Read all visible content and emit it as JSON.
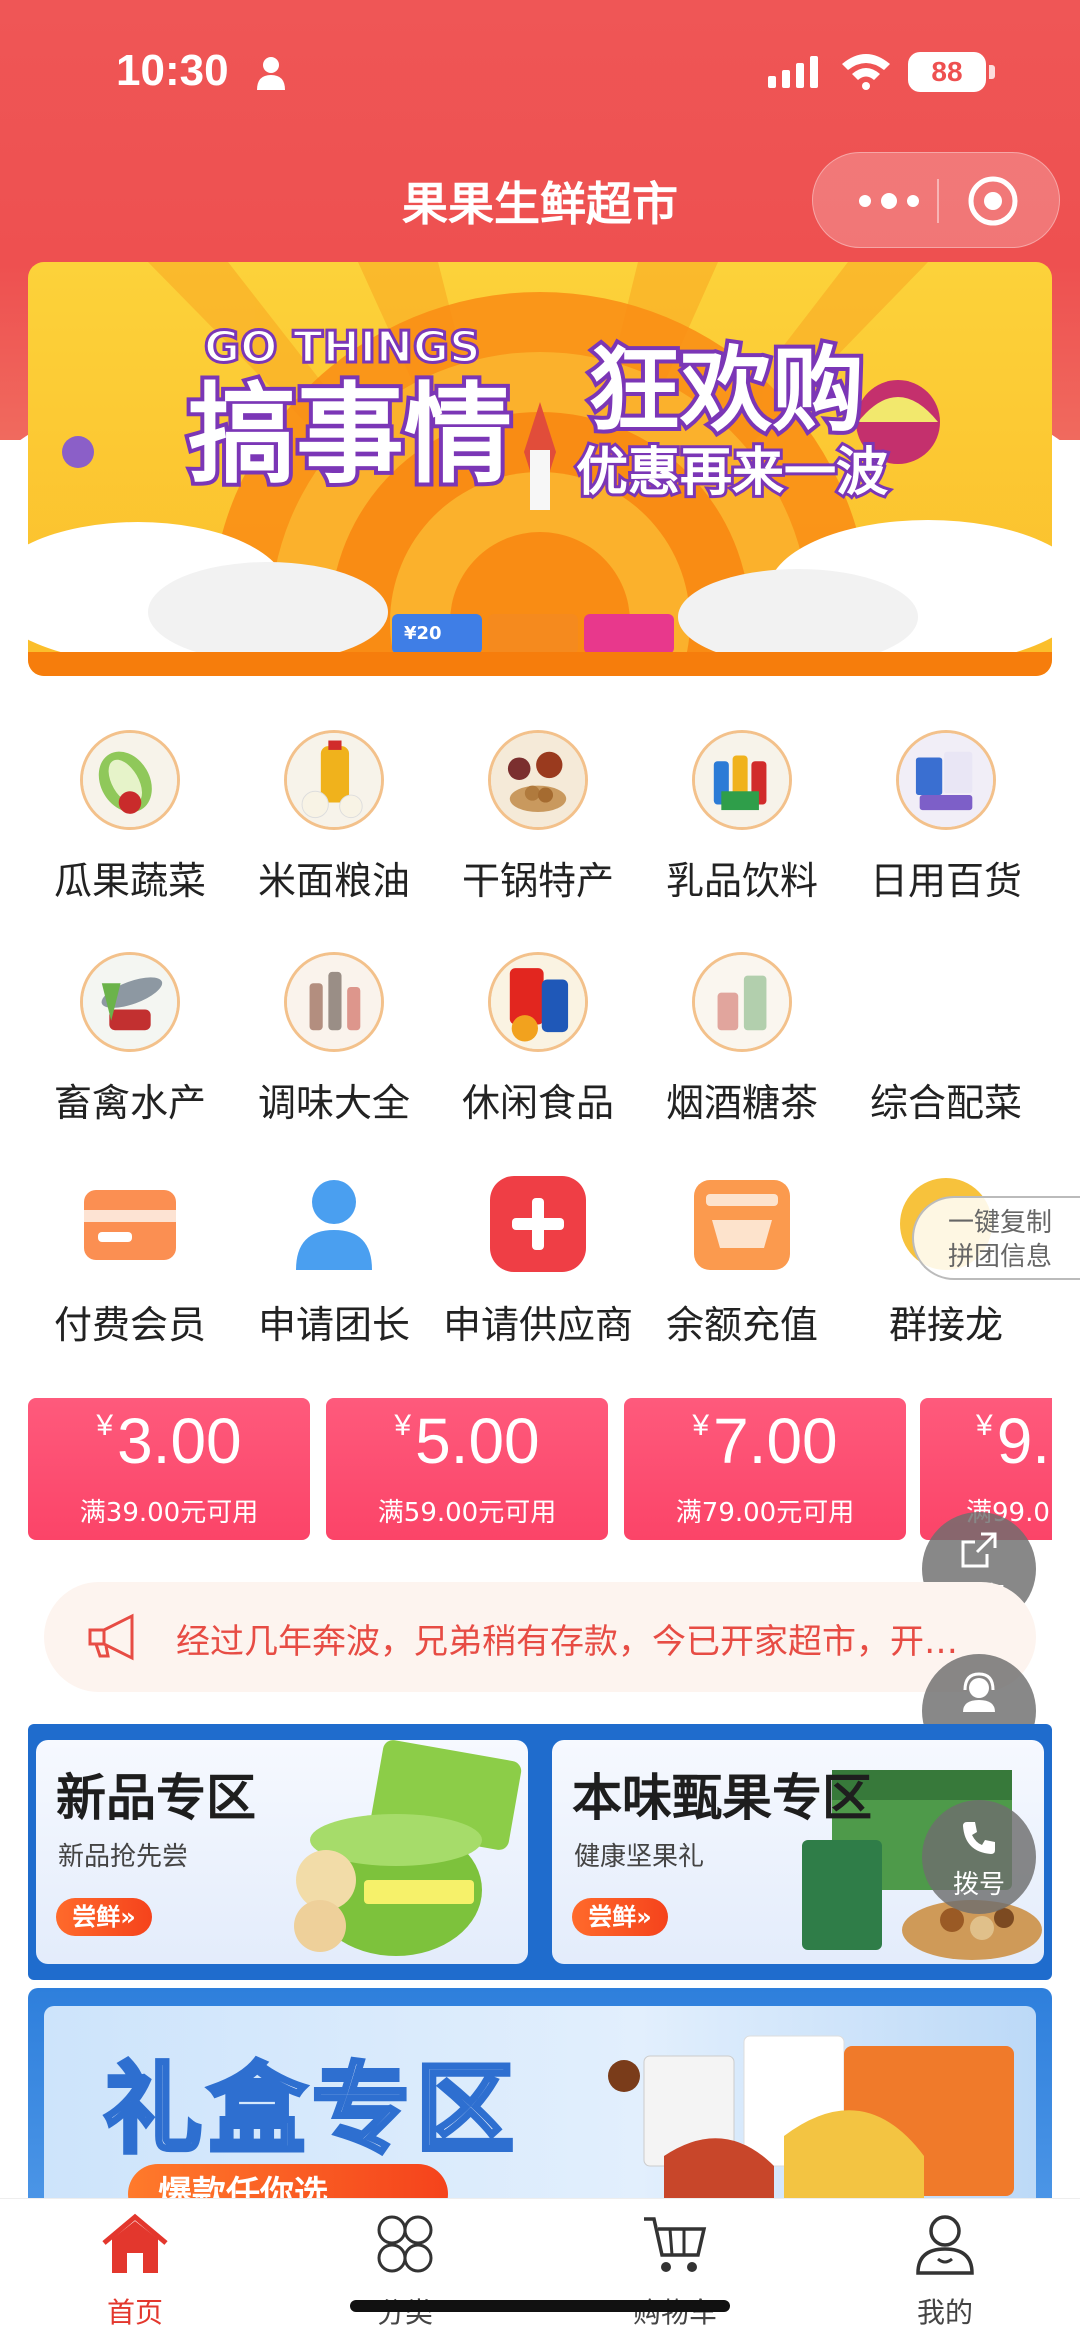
{
  "status_bar": {
    "time": "10:30",
    "battery": "88"
  },
  "nav": {
    "title": "果果生鲜超市"
  },
  "banner": {
    "en_text": "GO THINGS",
    "main_text": "搞事情",
    "right_text": "狂欢购",
    "sub_text": "优惠再来一波",
    "chips": [
      "¥20",
      "",
      ""
    ]
  },
  "categories": [
    {
      "label": "瓜果蔬菜",
      "icon": "vegetables-icon"
    },
    {
      "label": "米面粮油",
      "icon": "grain-oil-icon"
    },
    {
      "label": "干锅特产",
      "icon": "specialty-icon"
    },
    {
      "label": "乳品饮料",
      "icon": "drinks-icon"
    },
    {
      "label": "日用百货",
      "icon": "daily-goods-icon"
    },
    {
      "label": "畜禽水产",
      "icon": "meat-seafood-icon"
    },
    {
      "label": "调味大全",
      "icon": "seasoning-icon"
    },
    {
      "label": "休闲食品",
      "icon": "snacks-icon"
    },
    {
      "label": "烟酒糖茶",
      "icon": "liquor-tea-icon"
    },
    {
      "label": "综合配菜",
      "icon": "side-dish-icon"
    },
    {
      "label": "付费会员",
      "icon": "card-icon"
    },
    {
      "label": "申请团长",
      "icon": "person-icon"
    },
    {
      "label": "申请供应商",
      "icon": "plus-icon"
    },
    {
      "label": "余额充值",
      "icon": "wallet-icon"
    },
    {
      "label": "群接龙",
      "icon": "group-icon"
    }
  ],
  "coupons": [
    {
      "currency": "¥",
      "amount": "3.00",
      "condition": "满39.00元可用"
    },
    {
      "currency": "¥",
      "amount": "5.00",
      "condition": "满59.00元可用"
    },
    {
      "currency": "¥",
      "amount": "7.00",
      "condition": "满79.00元可用"
    },
    {
      "currency": "¥",
      "amount": "9.",
      "condition": "满99.0"
    }
  ],
  "notice": {
    "text": "经过几年奔波，兄弟稍有存款，今已开家超市，开…"
  },
  "promos": [
    {
      "title": "新品专区",
      "subtitle": "新品抢先尝",
      "button": "尝鲜»"
    },
    {
      "title": "本味甄果专区",
      "subtitle": "健康坚果礼",
      "button": "尝鲜»"
    }
  ],
  "gift": {
    "title": "礼盒专区",
    "tag": "爆款任你选"
  },
  "float": {
    "copy": [
      "一键复制",
      "拼团信息"
    ],
    "share": "分享",
    "service": "客服",
    "call": "拨号"
  },
  "tabbar": [
    {
      "label": "首页",
      "icon": "home-icon",
      "active": true
    },
    {
      "label": "分类",
      "icon": "category-icon",
      "active": false
    },
    {
      "label": "购物车",
      "icon": "cart-icon",
      "active": false
    },
    {
      "label": "我的",
      "icon": "profile-icon",
      "active": false
    }
  ],
  "colors": {
    "theme_red": "#ee5050",
    "coupon_pink": "#fb4468",
    "active_tab": "#e3372d"
  }
}
